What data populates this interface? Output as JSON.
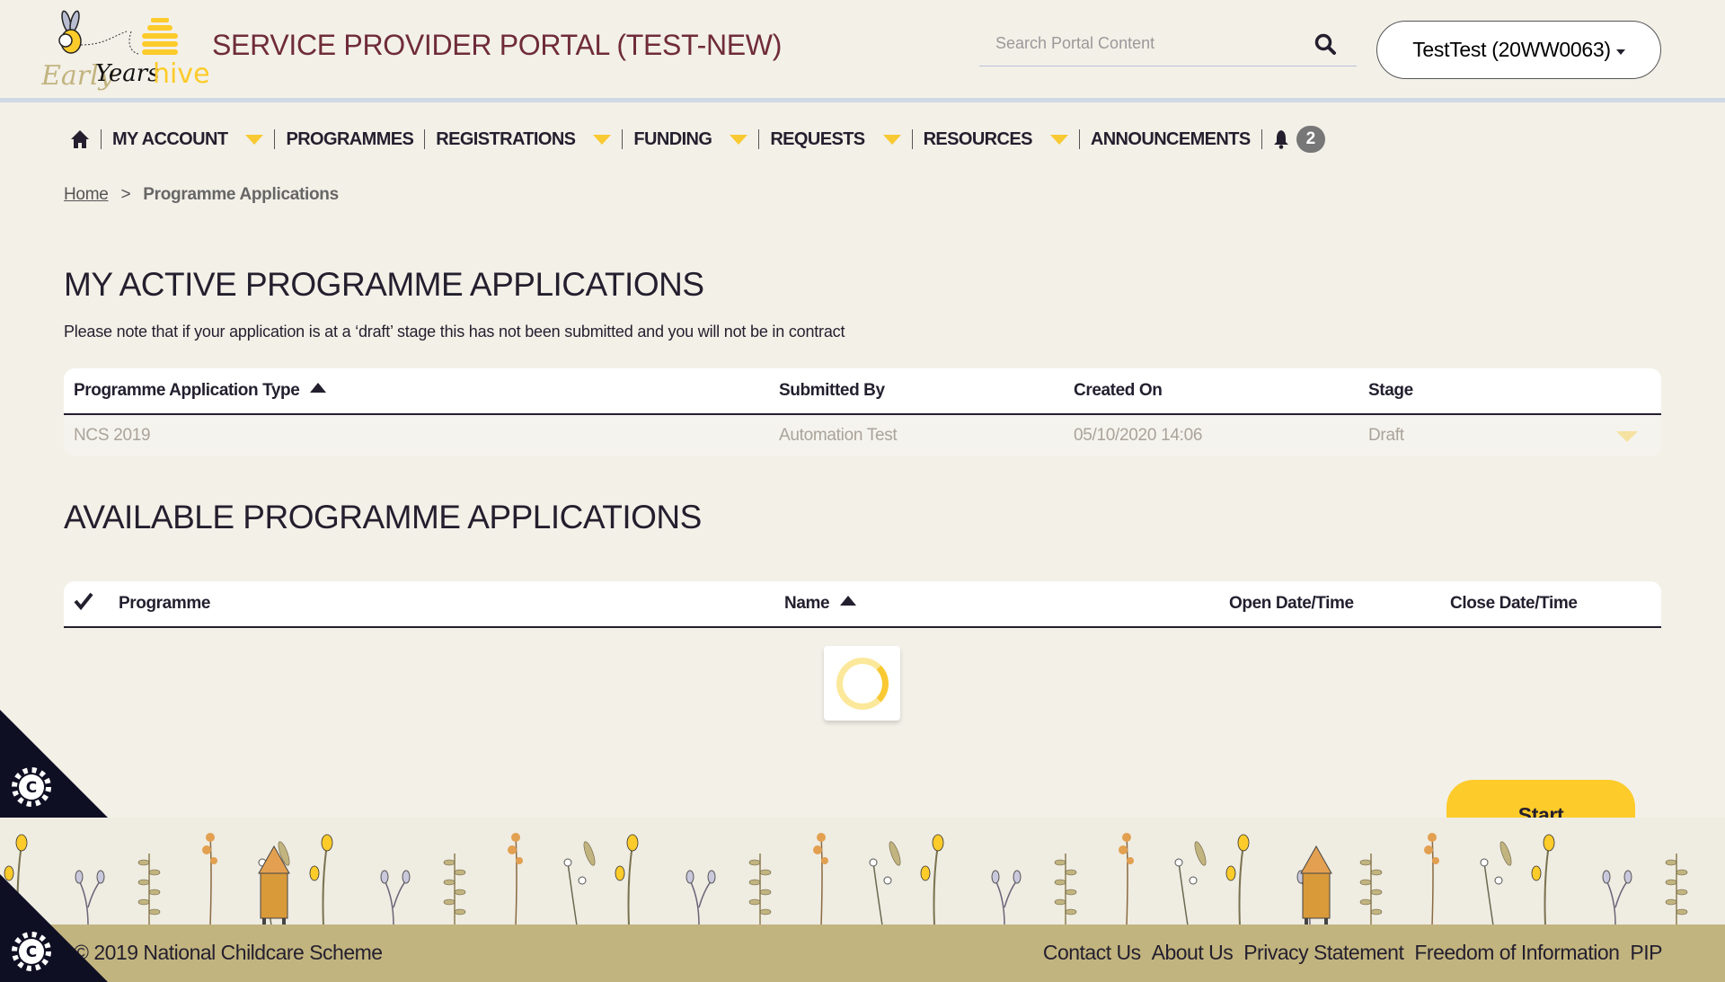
{
  "header": {
    "logo_text": {
      "early": "Early",
      "years": "Years",
      "hive": "hive"
    },
    "title": "SERVICE PROVIDER PORTAL (TEST-NEW)",
    "search_placeholder": "Search Portal Content",
    "user_menu_label": "TestTest (20WW0063)"
  },
  "nav": {
    "items": [
      {
        "label": "MY ACCOUNT",
        "dropdown": true
      },
      {
        "label": "PROGRAMMES",
        "dropdown": false
      },
      {
        "label": "REGISTRATIONS",
        "dropdown": true
      },
      {
        "label": "FUNDING",
        "dropdown": true
      },
      {
        "label": "REQUESTS",
        "dropdown": true
      },
      {
        "label": "RESOURCES",
        "dropdown": true
      },
      {
        "label": "ANNOUNCEMENTS",
        "dropdown": false
      }
    ],
    "notification_count": "2"
  },
  "breadcrumb": {
    "home": "Home",
    "separator": ">",
    "current": "Programme Applications"
  },
  "active": {
    "heading": "MY ACTIVE PROGRAMME APPLICATIONS",
    "note": "Please note that if your application is at a ‘draft’ stage this has not been submitted and you will not be in contract",
    "columns": [
      "Programme Application Type",
      "Submitted By",
      "Created On",
      "Stage"
    ],
    "rows": [
      {
        "type": "NCS 2019",
        "submitted_by": "Automation Test",
        "created_on": "05/10/2020 14:06",
        "stage": "Draft"
      }
    ]
  },
  "available": {
    "heading": "AVAILABLE PROGRAMME APPLICATIONS",
    "columns": [
      "Programme",
      "Name",
      "Open Date/Time",
      "Close Date/Time"
    ],
    "start_label": "Start"
  },
  "footer": {
    "copyright": "© 2019 National Childcare Scheme",
    "links": [
      "Contact Us",
      "About Us",
      "Privacy Statement",
      "Freedom of Information",
      "PIP"
    ]
  },
  "colors": {
    "accent": "#fdcb2a",
    "title": "#6f2c38",
    "background": "#f3f0e8",
    "footer": "#c2b47f",
    "dark": "#0f0f24"
  }
}
